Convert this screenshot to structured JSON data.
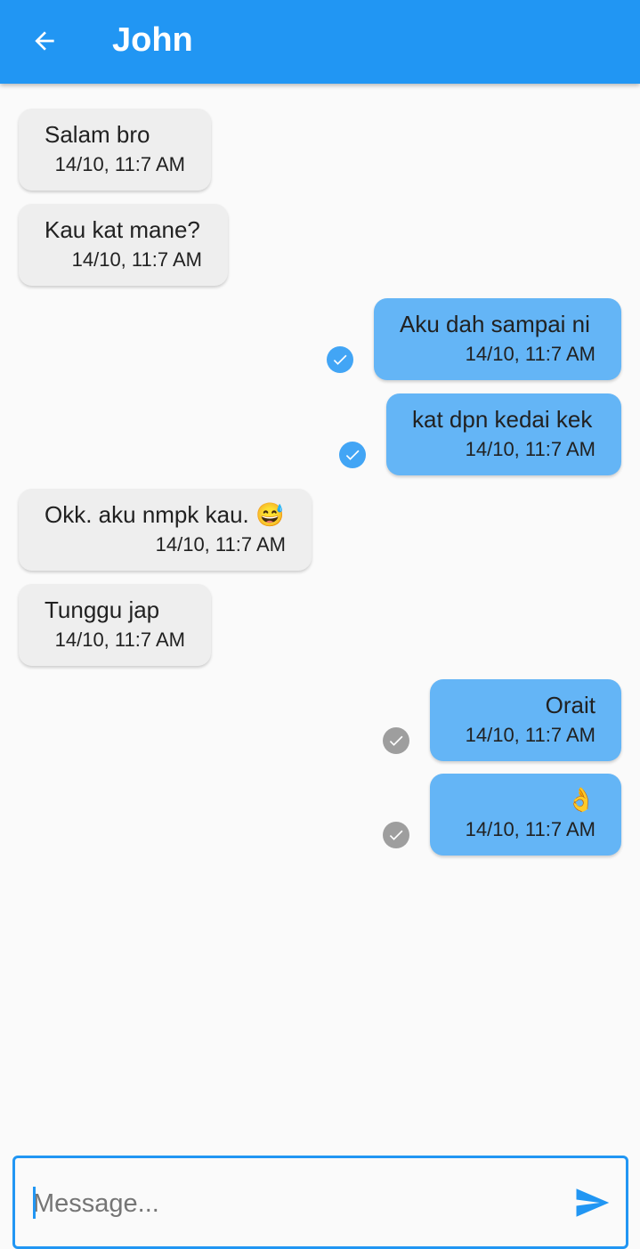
{
  "appbar": {
    "title": "John",
    "color": "#2196F3",
    "back_icon": "arrow-back-icon"
  },
  "messages": [
    {
      "direction": "incoming",
      "text": "Salam bro",
      "time": "14/10, 11:7 AM"
    },
    {
      "direction": "incoming",
      "text": "Kau kat mane?",
      "time": "14/10, 11:7 AM"
    },
    {
      "direction": "outgoing",
      "text": "Aku dah sampai ni",
      "time": "14/10, 11:7 AM",
      "status": "read"
    },
    {
      "direction": "outgoing",
      "text": "kat dpn kedai kek",
      "time": "14/10, 11:7 AM",
      "status": "read"
    },
    {
      "direction": "incoming",
      "text": "Okk. aku nmpk kau. 😅",
      "time": "14/10, 11:7 AM"
    },
    {
      "direction": "incoming",
      "text": "Tunggu jap",
      "time": "14/10, 11:7 AM"
    },
    {
      "direction": "outgoing",
      "text": "Orait",
      "time": "14/10, 11:7 AM",
      "status": "sent"
    },
    {
      "direction": "outgoing",
      "text": "👌",
      "time": "14/10, 11:7 AM",
      "status": "sent"
    }
  ],
  "colors": {
    "incoming_bubble": "#EEEEEE",
    "outgoing_bubble": "#64B5F6",
    "read_check": "#42A5F5",
    "sent_check": "#9E9E9E"
  },
  "composer": {
    "placeholder": "Message...",
    "value": "",
    "send_icon": "send-icon"
  }
}
